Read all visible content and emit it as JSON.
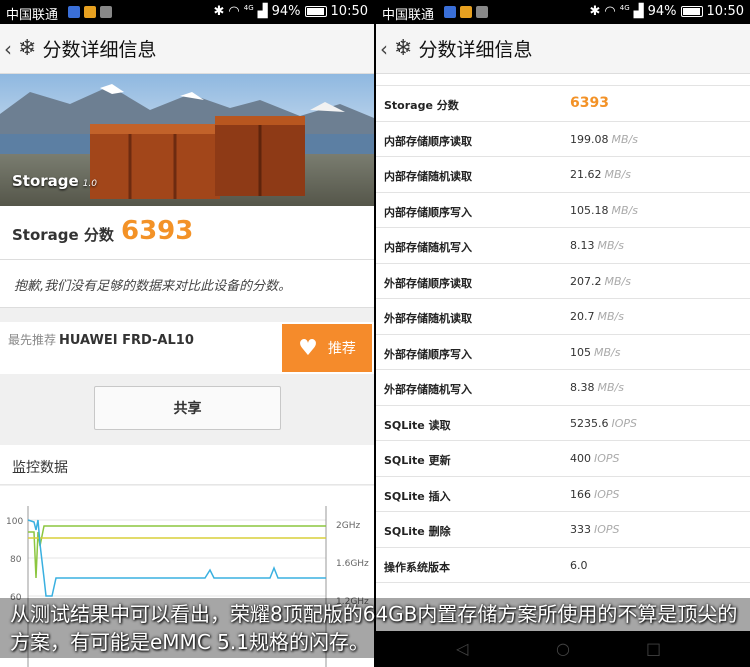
{
  "status": {
    "carrier": "中国联通",
    "net": "4G",
    "battery": "94%",
    "time": "10:50"
  },
  "title": "分数详细信息",
  "left": {
    "hero_label": "Storage",
    "hero_version": "1.0",
    "score_label": "Storage 分数",
    "score_value": "6393",
    "notice": "抱歉,我们没有足够的数据来对比此设备的分数。",
    "recommend_prefix": "最先推荐",
    "recommend_device": "HUAWEI FRD-AL10",
    "recommend_button": "推荐",
    "share_button": "共享",
    "monitor_title": "监控数据"
  },
  "chart_data": {
    "type": "line",
    "y_left_ticks": [
      "100",
      "80",
      "60"
    ],
    "y_right_ticks": [
      "2GHz",
      "1.6GHz",
      "1.2GHz"
    ]
  },
  "right": {
    "rows": [
      {
        "key": "Storage 分数",
        "value": "6393",
        "unit": ""
      },
      {
        "key": "内部存储顺序读取",
        "value": "199.08",
        "unit": "MB/s"
      },
      {
        "key": "内部存储随机读取",
        "value": "21.62",
        "unit": "MB/s"
      },
      {
        "key": "内部存储顺序写入",
        "value": "105.18",
        "unit": "MB/s"
      },
      {
        "key": "内部存储随机写入",
        "value": "8.13",
        "unit": "MB/s"
      },
      {
        "key": "外部存储顺序读取",
        "value": "207.2",
        "unit": "MB/s"
      },
      {
        "key": "外部存储随机读取",
        "value": "20.7",
        "unit": "MB/s"
      },
      {
        "key": "外部存储顺序写入",
        "value": "105",
        "unit": "MB/s"
      },
      {
        "key": "外部存储随机写入",
        "value": "8.38",
        "unit": "MB/s"
      },
      {
        "key": "SQLite 读取",
        "value": "5235.6",
        "unit": "IOPS"
      },
      {
        "key": "SQLite 更新",
        "value": "400",
        "unit": "IOPS"
      },
      {
        "key": "SQLite 插入",
        "value": "166",
        "unit": "IOPS"
      },
      {
        "key": "SQLite 删除",
        "value": "333",
        "unit": "IOPS"
      },
      {
        "key": "操作系统版本",
        "value": "6.0",
        "unit": ""
      }
    ]
  },
  "caption": "从测试结果中可以看出，荣耀8顶配版的64GB内置存储方案所使用的不算是顶尖的方案，有可能是eMMC 5.1规格的闪存。",
  "colors": {
    "accent": "#f39227",
    "button": "#f58b2b"
  }
}
